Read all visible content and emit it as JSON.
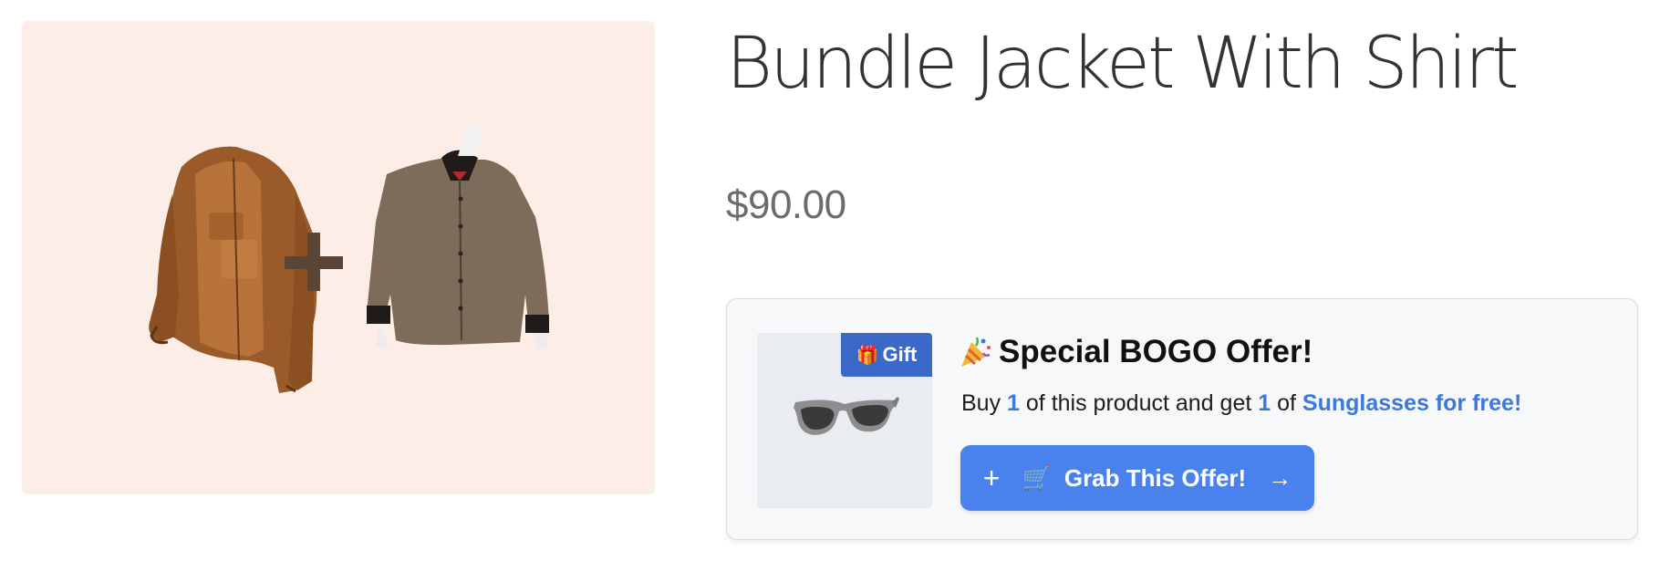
{
  "product": {
    "title": "Bundle Jacket With Shirt",
    "price": "$90.00"
  },
  "offer": {
    "badge_label": "Gift",
    "badge_icon": "gift-icon",
    "heading_icon": "party-popper-icon",
    "heading": "Special BOGO Offer!",
    "desc_buy": "Buy",
    "buy_qty": "1",
    "desc_middle": "of this product and get",
    "get_qty": "1",
    "desc_of": "of",
    "gift_product": "Sunglasses",
    "desc_free": "for free!",
    "button_label": "Grab This Offer!",
    "button_icons": [
      "plus-icon",
      "cart-icon",
      "arrow-right-icon"
    ]
  },
  "colors": {
    "image_bg": "#fcede7",
    "accent": "#4a82ed",
    "badge": "#3b69c9",
    "link": "#3b78e0"
  }
}
